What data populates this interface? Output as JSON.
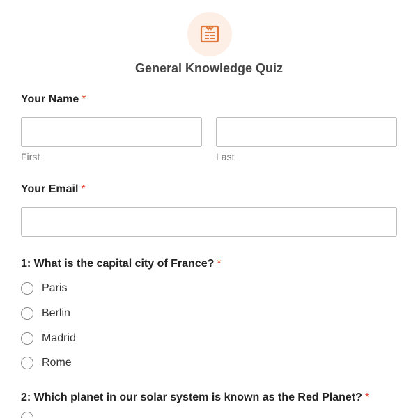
{
  "form": {
    "title": "General Knowledge Quiz",
    "logo_icon": "quiz-document-icon",
    "accent_color": "#e2773a",
    "required_marker": "*"
  },
  "name_field": {
    "label": "Your Name",
    "first_sublabel": "First",
    "last_sublabel": "Last",
    "first_value": "",
    "last_value": ""
  },
  "email_field": {
    "label": "Your Email",
    "value": ""
  },
  "questions": [
    {
      "label": "1: What is the capital city of France?",
      "options": [
        "Paris",
        "Berlin",
        "Madrid",
        "Rome"
      ]
    },
    {
      "label": "2: Which planet in our solar system is known as the Red Planet?"
    }
  ]
}
